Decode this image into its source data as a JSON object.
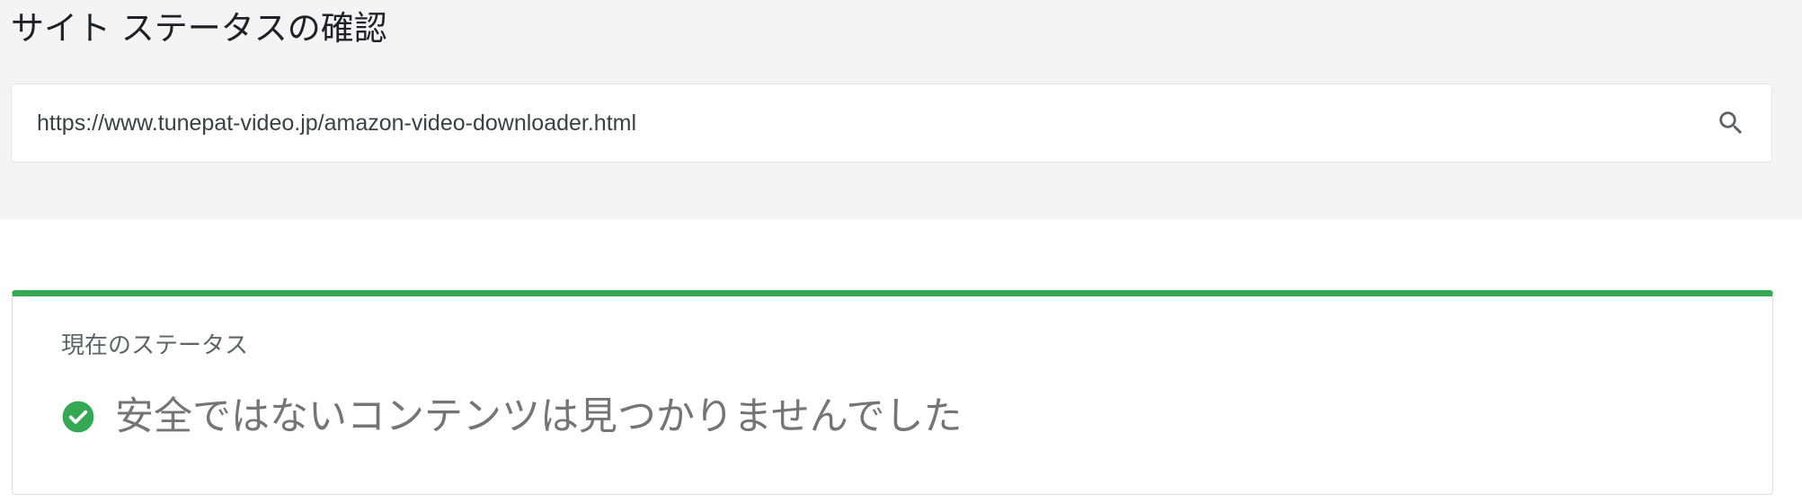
{
  "page": {
    "title": "サイト ステータスの確認"
  },
  "search": {
    "value": "https://www.tunepat-video.jp/amazon-video-downloader.html",
    "button_icon": "search-icon"
  },
  "status": {
    "label": "現在のステータス",
    "message": "安全ではないコンテンツは見つかりませんでした",
    "icon": "check-circle-icon"
  },
  "colors": {
    "accent_green": "#34a853",
    "top_background": "#f4f4f4"
  }
}
